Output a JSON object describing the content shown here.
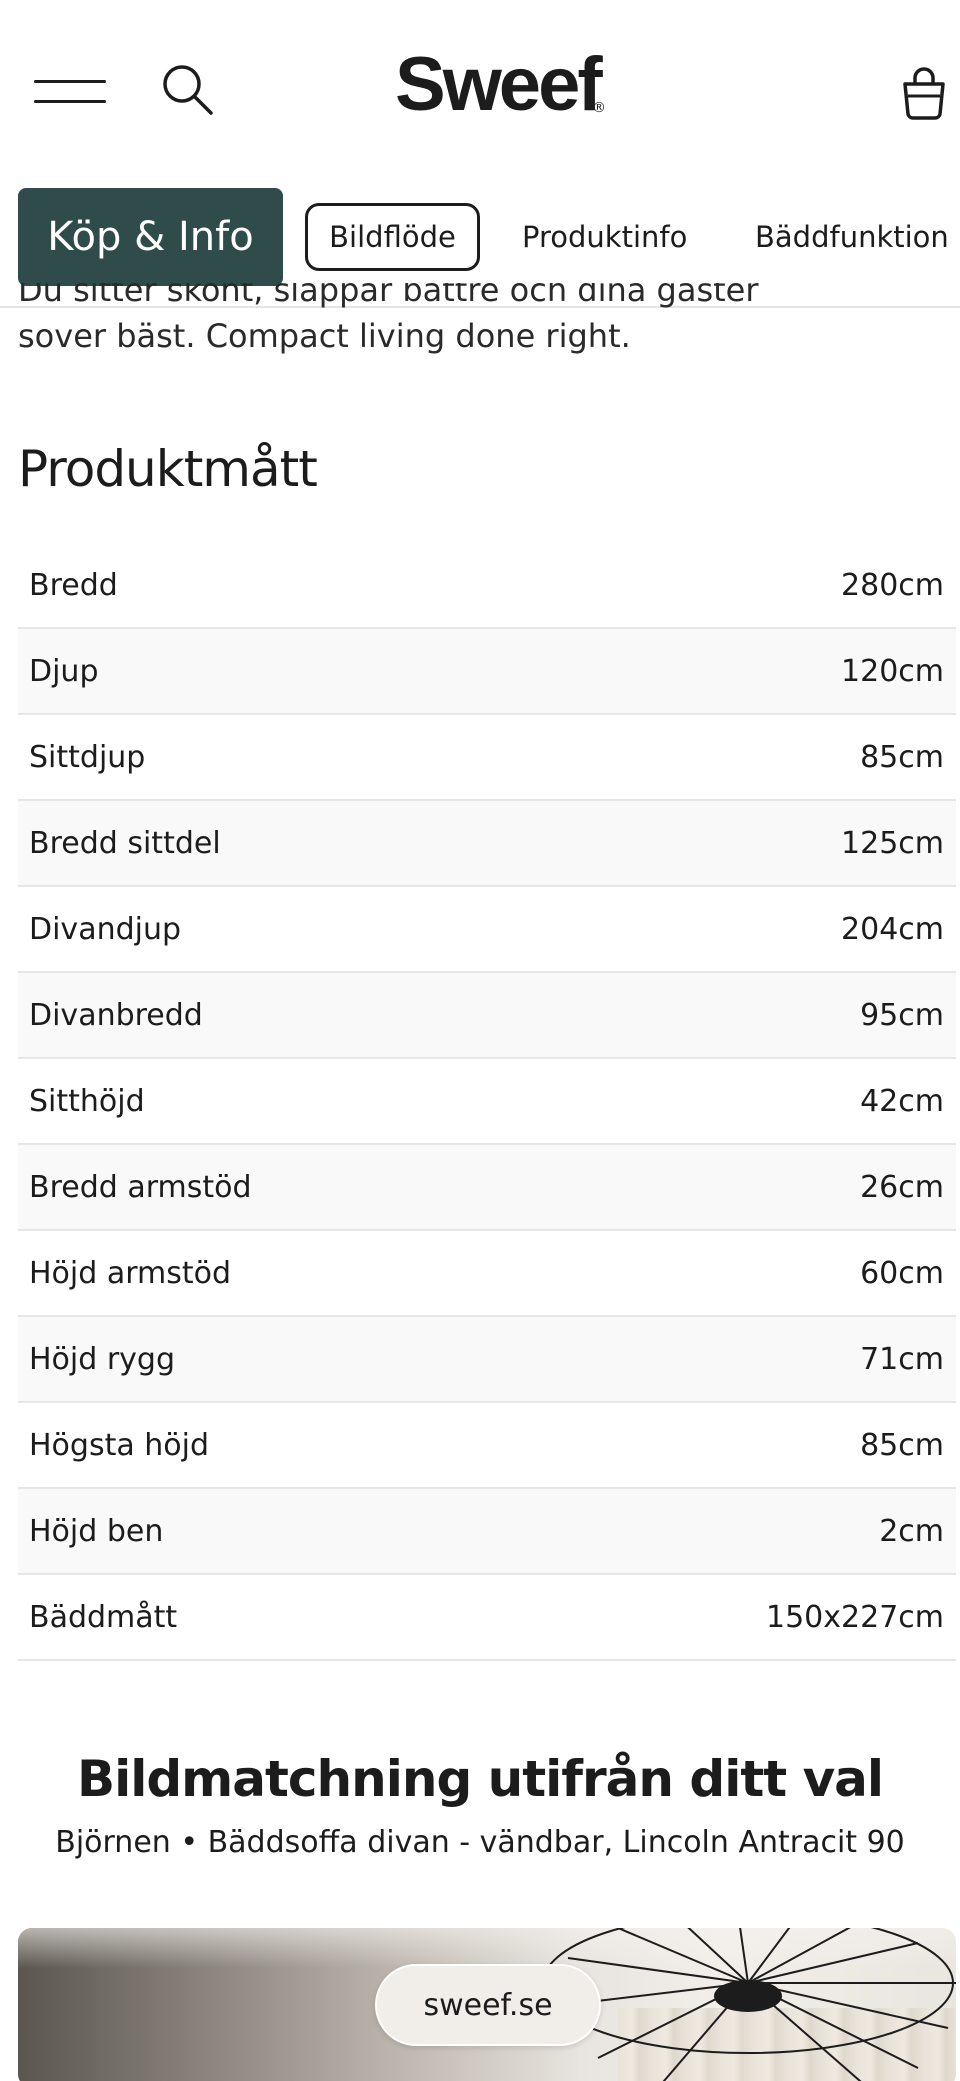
{
  "header": {
    "logo_text": "Sweef",
    "logo_mark": "®",
    "icons": [
      "menu-icon",
      "search-icon",
      "shopping-bag-icon"
    ]
  },
  "tabs": {
    "primary": "Köp & Info",
    "items": [
      {
        "label": "Bildflöde",
        "active": true
      },
      {
        "label": "Produktinfo",
        "active": false
      },
      {
        "label": "Bäddfunktion",
        "active": false
      }
    ]
  },
  "intro": {
    "line1_partial": "Du sitter skönt, slappar bättre och dina gäster",
    "line2": "sover bäst. Compact living done right."
  },
  "specs": {
    "title": "Produktmått",
    "rows": [
      {
        "label": "Bredd",
        "value": "280cm"
      },
      {
        "label": "Djup",
        "value": "120cm"
      },
      {
        "label": "Sittdjup",
        "value": "85cm"
      },
      {
        "label": "Bredd sittdel",
        "value": "125cm"
      },
      {
        "label": "Divandjup",
        "value": "204cm"
      },
      {
        "label": "Divanbredd",
        "value": "95cm"
      },
      {
        "label": "Sitthöjd",
        "value": "42cm"
      },
      {
        "label": "Bredd armstöd",
        "value": "26cm"
      },
      {
        "label": "Höjd armstöd",
        "value": "60cm"
      },
      {
        "label": "Höjd rygg",
        "value": "71cm"
      },
      {
        "label": "Högsta höjd",
        "value": "85cm"
      },
      {
        "label": "Höjd ben",
        "value": "2cm"
      },
      {
        "label": "Bäddmått",
        "value": "150x227cm"
      }
    ]
  },
  "matching": {
    "title": "Bildmatchning utifrån ditt val",
    "subtitle": "Björnen • Bäddsoffa divan - vändbar, Lincoln Antracit 90",
    "image_url_label": "sweef.se"
  },
  "colors": {
    "primary_tab_bg": "#2f4b4a",
    "text": "#1c1c1c",
    "row_alt_bg": "#f9f9f9"
  }
}
